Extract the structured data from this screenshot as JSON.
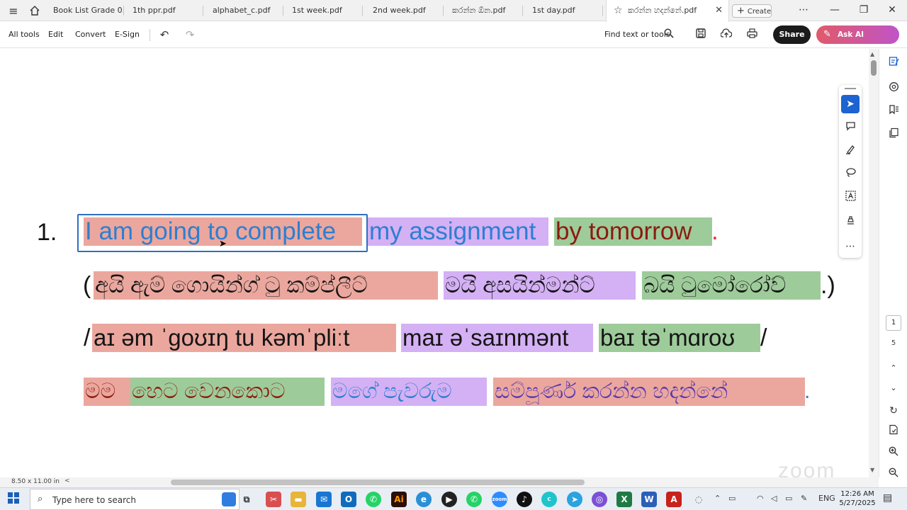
{
  "tabs": [
    {
      "label": "Book  List Grade 0..."
    },
    {
      "label": "1th ppr.pdf"
    },
    {
      "label": "alphabet_c.pdf"
    },
    {
      "label": "1st week.pdf"
    },
    {
      "label": "2nd week.pdf"
    },
    {
      "label": "කරන්න ඕන.pdf"
    },
    {
      "label": "1st day.pdf"
    },
    {
      "label": "කරන්න හදන්නේ.pdf"
    }
  ],
  "create_label": "Create",
  "menu": {
    "all_tools": "All tools",
    "edit": "Edit",
    "convert": "Convert",
    "esign": "E-Sign"
  },
  "find_label": "Find text or tools",
  "share_label": "Share",
  "ai_label": "Ask AI Assistant",
  "document": {
    "item_number": "1.",
    "english": [
      {
        "text": "I am going to complete",
        "highlight": "#eba79e",
        "color": "#2d7fd0"
      },
      {
        "text": "my assignment",
        "highlight": "#d4b0f4",
        "color": "#2d7fd0"
      },
      {
        "text": "by tomorrow",
        "highlight": "#9ecb9a",
        "color": "#8b1b10"
      },
      {
        "text": "."
      }
    ],
    "sinhala_pron": {
      "open": "(",
      "segments": [
        "අයි ඇම් ගොයින්ග් ටු කම්ප්ලීට්",
        "මයි අසයින්මන්ට්",
        "බයි ටුමෝරෝව්"
      ],
      "close": ".)"
    },
    "ipa": {
      "open": "/",
      "segments": [
        "aɪ əm ˈɡoʊɪŋ tu kəmˈpliːt",
        "maɪ əˈsaɪnmənt",
        "baɪ təˈmɑroʊ"
      ],
      "close": "/"
    },
    "sinhala_meaning": {
      "segments": [
        "මම",
        "හෙට වෙනකොට",
        "මගේ පැවරුම",
        "සම්පූර්ණ කරන්න හදන්නේ"
      ],
      "end": "."
    }
  },
  "page": {
    "current": "1",
    "total": "5",
    "size": "8.50 x 11.00 in"
  },
  "watermark": "zoom",
  "taskbar": {
    "search_placeholder": "Type here to search",
    "lang": "ENG",
    "time": "12:26 AM",
    "date": "5/27/2025",
    "badge": "99"
  },
  "colors": {
    "accent": "#1d63d1",
    "share_bg": "#1b1b1b",
    "ai_start": "#e05a6a",
    "ai_end": "#c054c8"
  },
  "icons": [
    "menu-icon",
    "home-icon",
    "star-icon",
    "close-icon",
    "undo-icon",
    "redo-icon",
    "search-icon",
    "save-icon",
    "upload-icon",
    "print-icon",
    "cursor-icon",
    "comment-icon",
    "highlight-icon",
    "lasso-icon",
    "text-select-icon",
    "stamp-icon"
  ]
}
